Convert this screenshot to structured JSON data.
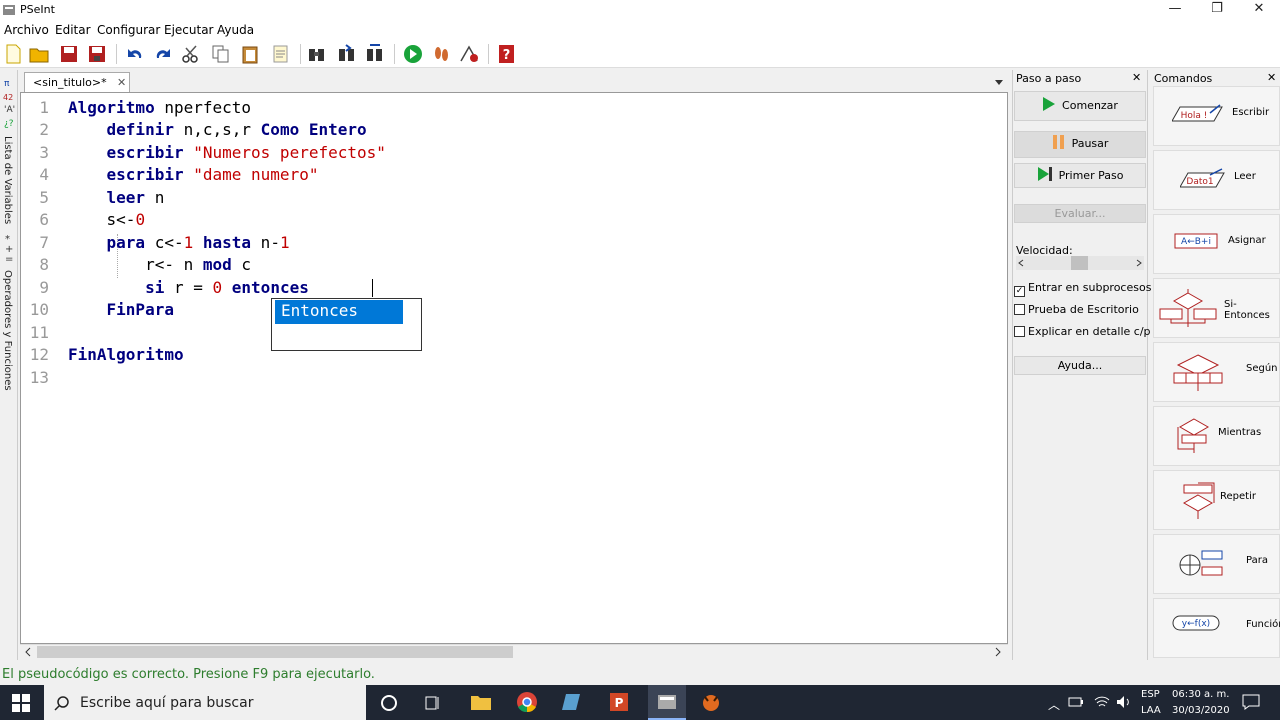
{
  "window": {
    "title": "PSeInt",
    "minimize": "—",
    "maximize": "❐",
    "close": "✕"
  },
  "menu": [
    "Archivo",
    "Editar",
    "Configurar",
    "Ejecutar",
    "Ayuda"
  ],
  "toolbar": {
    "icons": [
      "new-file-icon",
      "open-folder-icon",
      "save-icon",
      "save-as-icon",
      "undo-icon",
      "redo-icon",
      "cut-icon",
      "copy-icon",
      "paste-icon",
      "edit-icon",
      "find-icon",
      "find-next-icon",
      "replace-icon",
      "run-icon",
      "step-icon",
      "debug-icon",
      "help-icon"
    ]
  },
  "leftrail": {
    "variables": "Lista de Variables",
    "operators": "Operadores y Funciones"
  },
  "editor": {
    "tab": "<sin_titulo>*",
    "tab_close": "✕",
    "line_numbers": [
      "1",
      "2",
      "3",
      "4",
      "5",
      "6",
      "7",
      "8",
      "9",
      "10",
      "11",
      "12",
      "13"
    ],
    "autocomplete": "Entonces"
  },
  "status": "El pseudocódigo es correcto. Presione F9 para ejecutarlo.",
  "step_panel": {
    "title": "Paso a paso",
    "close": "✕",
    "start": "Comenzar",
    "pause": "Pausar",
    "first_step": "Primer Paso",
    "evaluate": "Evaluar...",
    "speed_label": "Velocidad:",
    "enter_subprocesses": "Entrar en subprocesos",
    "desk_check": "Prueba de Escritorio",
    "explain": "Explicar en detalle c/paso",
    "help": "Ayuda..."
  },
  "commands": {
    "title": "Comandos",
    "close": "✕",
    "items": [
      "Escribir",
      "Leer",
      "Asignar",
      "Si-Entonces",
      "Según",
      "Mientras",
      "Repetir",
      "Para",
      "Función"
    ],
    "glyph_write": "Hola !",
    "glyph_read": "Dato1",
    "glyph_assign": "A←B+i",
    "glyph_func": "y←f(x)"
  },
  "taskbar": {
    "search": "Escribe aquí para buscar",
    "lang": "ESP",
    "layout": "LAA",
    "time": "06:30 a. m.",
    "date": "30/03/2020"
  }
}
